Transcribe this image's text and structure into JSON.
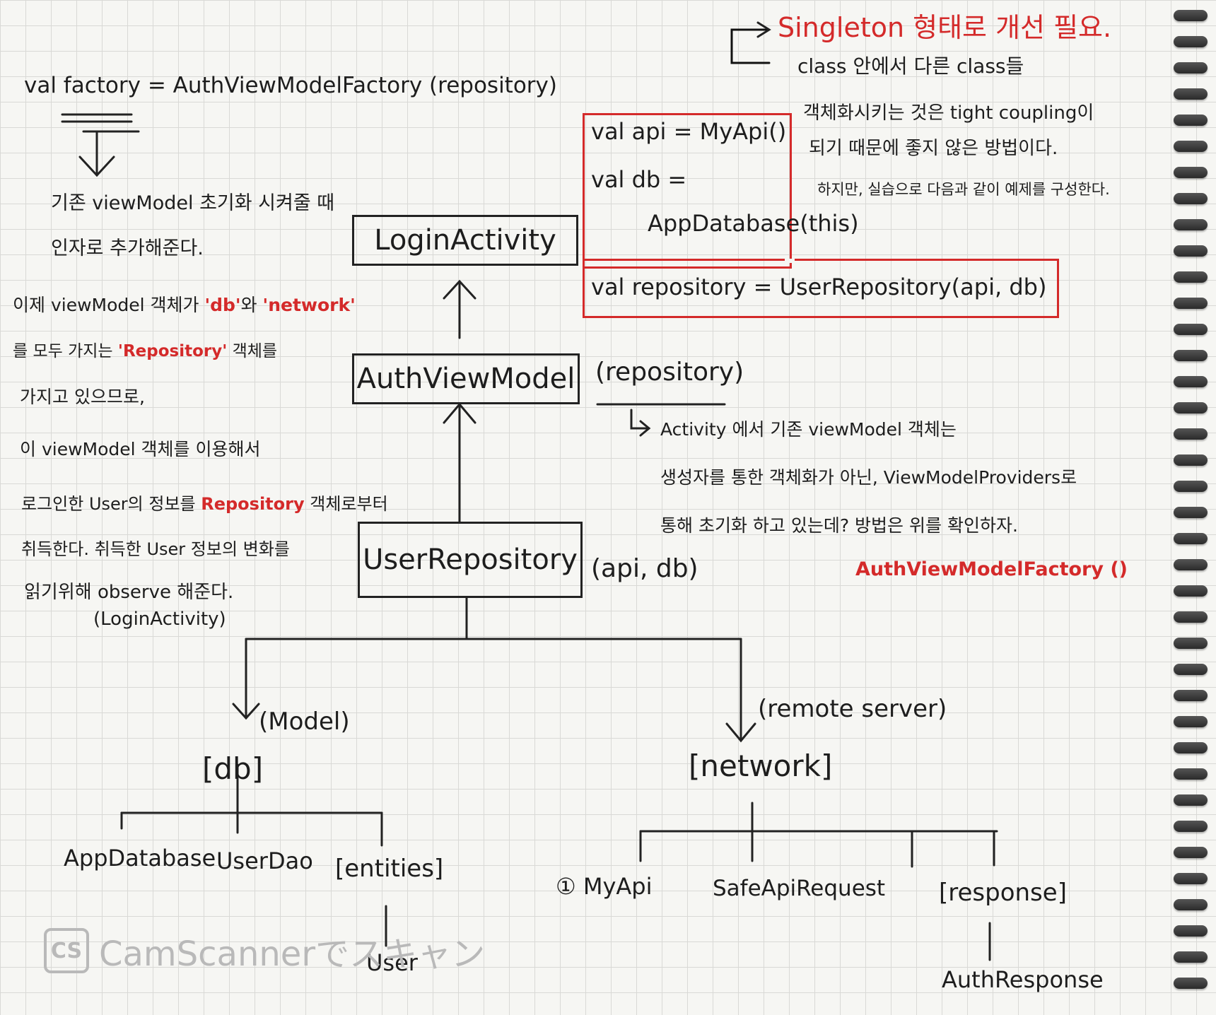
{
  "top_right_note": {
    "title": "Singleton 형태로 개선 필요.",
    "line1": "class 안에서 다른 class들",
    "line2": "객체화시키는 것은 tight coupling이",
    "line3": "되기 때문에 좋지 않은 방법이다.",
    "line4": "하지만, 실습으로 다음과 같이 예제를 구성한다."
  },
  "factory_line": "val factory = AuthViewModelFactory (repository)",
  "left_notes": {
    "init_line1": "기존 viewModel 초기화 시켜줄 때",
    "init_line2": "인자로 추가해준다.",
    "now_prefix": "이제 viewModel 객체가 ",
    "now_db": "'db'",
    "now_and": "와 ",
    "now_network": "'network'",
    "all_prefix": "를 모두 가지는 ",
    "all_repo": "'Repository'",
    "all_suffix": " 객체를",
    "having": "가지고 있으므로,",
    "use": "이 viewModel 객체를 이용해서",
    "login_prefix": "로그인한 User의 정보를 ",
    "login_repo": "Repository",
    "login_suffix": " 객체로부터",
    "obtain": "취득한다. 취득한 User 정보의 변화를",
    "observe": "읽기위해 observe 해준다.",
    "observe_ctx": "(LoginActivity)"
  },
  "code_box": {
    "line1": "val api = MyApi()",
    "line2": "val db =",
    "line3": "AppDatabase(this)",
    "line4": "val repository = UserRepository(api, db)"
  },
  "boxes": {
    "login_activity": "LoginActivity",
    "auth_view_model": "AuthViewModel",
    "user_repository": "UserRepository"
  },
  "params": {
    "auth_view_model": "(repository)",
    "user_repository": "(api, db)"
  },
  "right_note": {
    "line1": "Activity 에서 기존 viewModel 객체는",
    "line2": "생성자를 통한 객체화가 아닌, ViewModelProviders로",
    "line3": "통해 초기화 하고 있는데? 방법은 위를 확인하자.",
    "factory": "AuthViewModelFactory ()"
  },
  "tree": {
    "model_label": "(Model)",
    "remote_label": "(remote server)",
    "db": "[db]",
    "network": "[network]",
    "db_children": [
      "AppDatabase",
      "UserDao",
      "[entities]"
    ],
    "entities_child": "User",
    "network_children": [
      "① MyApi",
      "SafeApiRequest",
      "[response]"
    ],
    "response_child": "AuthResponse"
  },
  "watermark": {
    "logo": "CS",
    "text": "CamScannerでスキャン"
  },
  "colors": {
    "ink": "#1d1d1d",
    "red": "#d42a2a",
    "paper": "#f6f6f3",
    "grid": "#d9d9d6"
  }
}
